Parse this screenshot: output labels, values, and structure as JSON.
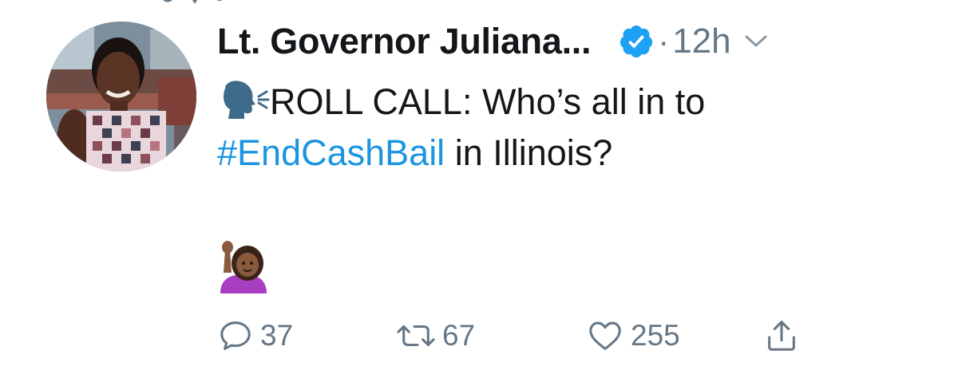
{
  "tweet": {
    "author_name": "Lt. Governor Juliana...",
    "separator": "·",
    "time": "12h",
    "text_line1": "ROLL CALL: Who’s all in to",
    "hashtag": "#EndCashBail",
    "text_line2_rest": " in Illinois?"
  },
  "actions": {
    "reply_count": "37",
    "retweet_count": "67",
    "like_count": "255"
  },
  "colors": {
    "text": "#14171a",
    "muted": "#657786",
    "link": "#1b95e0",
    "verified": "#1da1f2"
  },
  "icons": [
    "verified-badge-icon",
    "chevron-down-icon",
    "speaking-head-emoji",
    "person-raising-hand-emoji",
    "reply-icon",
    "retweet-icon",
    "like-icon",
    "share-icon"
  ]
}
